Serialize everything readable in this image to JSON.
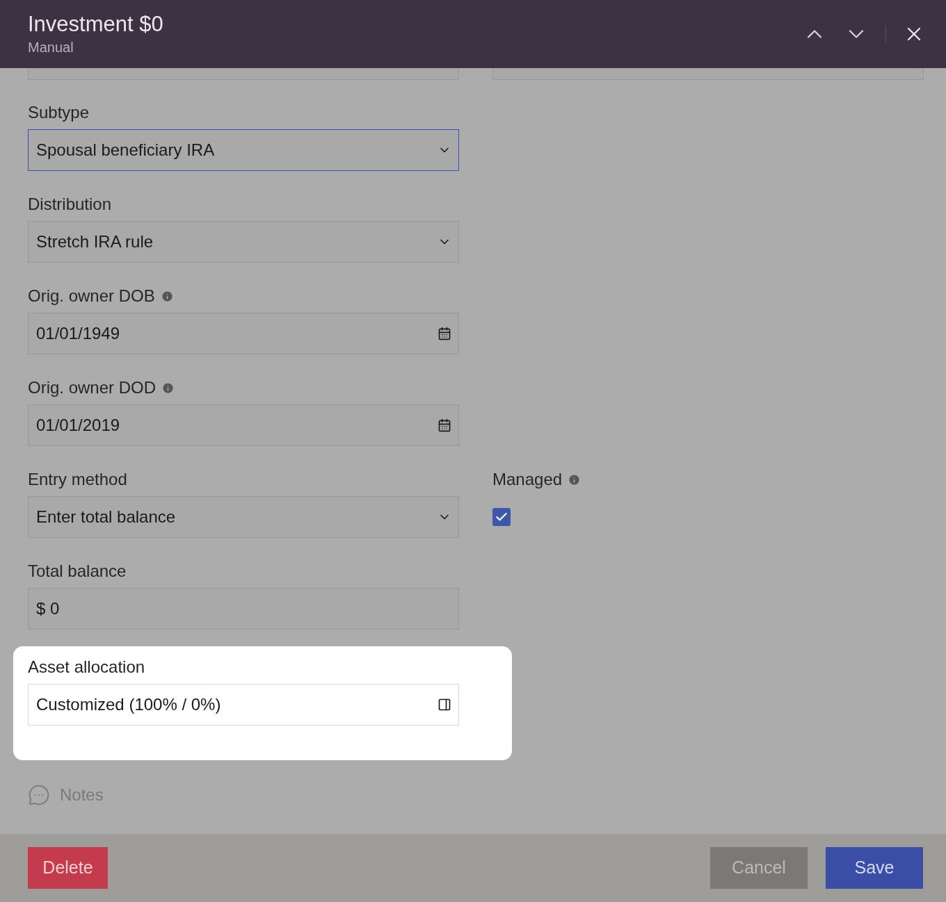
{
  "header": {
    "title": "Investment $0",
    "subtitle": "Manual"
  },
  "rows": [
    {
      "fields": [
        {
          "kind": "select",
          "label": "Subtype",
          "value": "Spousal beneficiary IRA",
          "info": false,
          "focused": true,
          "highlighted": false
        }
      ]
    },
    {
      "fields": [
        {
          "kind": "select",
          "label": "Distribution",
          "value": "Stretch IRA rule",
          "info": false,
          "focused": false,
          "highlighted": false
        }
      ]
    },
    {
      "fields": [
        {
          "kind": "date",
          "label": "Orig. owner DOB",
          "value": "01/01/1949",
          "info": true,
          "focused": false,
          "highlighted": false
        }
      ]
    },
    {
      "fields": [
        {
          "kind": "date",
          "label": "Orig. owner DOD",
          "value": "01/01/2019",
          "info": true,
          "focused": false,
          "highlighted": false
        }
      ]
    },
    {
      "fields": [
        {
          "kind": "select",
          "label": "Entry method",
          "value": "Enter total balance",
          "info": false,
          "focused": false,
          "highlighted": false
        },
        {
          "kind": "checkbox",
          "label": "Managed",
          "checked": true,
          "info": true,
          "highlighted": false
        }
      ]
    },
    {
      "fields": [
        {
          "kind": "text",
          "label": "Total balance",
          "value": "$ 0",
          "info": false,
          "focused": false,
          "highlighted": false
        }
      ]
    },
    {
      "fields": [
        {
          "kind": "picker",
          "label": "Asset allocation",
          "value": "Customized (100% / 0%)",
          "info": false,
          "focused": false,
          "highlighted": true
        }
      ]
    }
  ],
  "notes": {
    "label": "Notes"
  },
  "buttons": [
    {
      "label": "Delete",
      "kind": "danger"
    },
    {
      "label": "Cancel",
      "kind": "secondary"
    },
    {
      "label": "Save",
      "kind": "primary"
    }
  ]
}
